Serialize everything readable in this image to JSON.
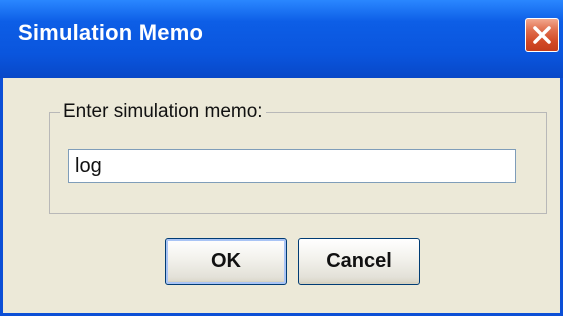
{
  "window": {
    "title": "Simulation Memo"
  },
  "memo_group": {
    "label": "Enter simulation memo:",
    "input_value": "log"
  },
  "buttons": {
    "ok_label": "OK",
    "cancel_label": "Cancel"
  },
  "colors": {
    "titlebar": "#0a55dd",
    "close_button": "#d24a26",
    "dialog_background": "#ece9d8"
  },
  "icons": {
    "close": "close-icon"
  }
}
